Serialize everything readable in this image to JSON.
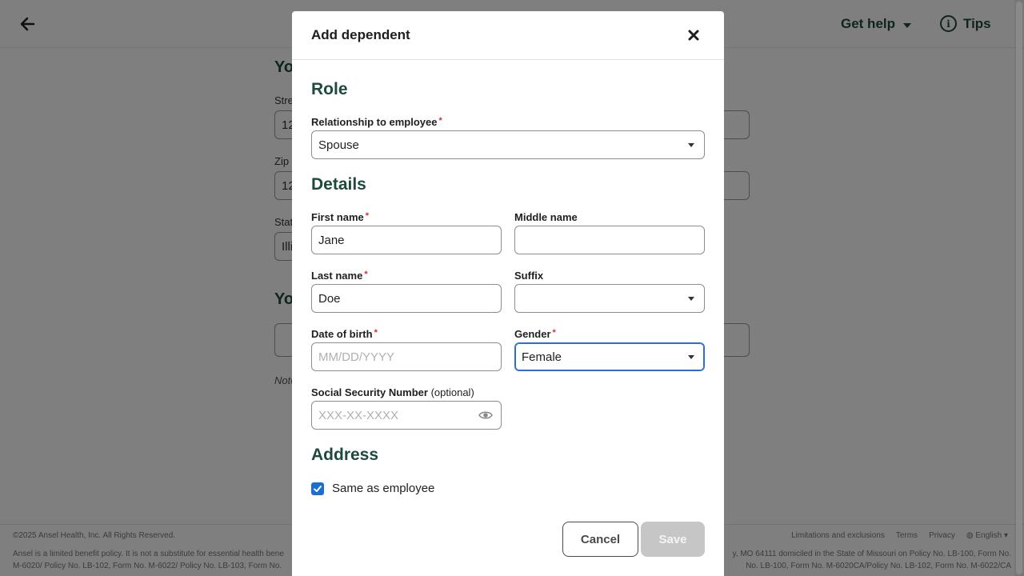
{
  "header": {
    "get_help_label": "Get help",
    "tips_label": "Tips",
    "tips_icon": "i"
  },
  "background": {
    "heading_1": "Yo",
    "street_label": "Stre",
    "street_value": "12",
    "zip_label": "Zip c",
    "zip_value": "12",
    "state_label": "Stat",
    "state_value": "Illi",
    "heading_2": "Yo",
    "note": "Note"
  },
  "footer": {
    "copyright": "©2025 Ansel Health, Inc. All Rights Reserved.",
    "links": [
      "Limitations and exclusions",
      "Terms",
      "Privacy",
      "English"
    ],
    "legal_left": "Ansel is a limited benefit policy. It is not a substitute for essential health bene",
    "legal_left_2": "M-6020/ Policy No. LB-102, Form No. M-6022/ Policy No. LB-103, Form No.",
    "legal_right": "y, MO 64111 domiciled in the State of Missouri on Policy No. LB-100, Form No.",
    "legal_right_2": "No. LB-100, Form No. M-6020CA/Policy No. LB-102, Form No. M-6022/CA"
  },
  "modal": {
    "title": "Add dependent",
    "role_heading": "Role",
    "relationship_label": "Relationship to employee",
    "relationship_value": "Spouse",
    "details_heading": "Details",
    "first_name_label": "First name",
    "first_name_value": "Jane",
    "middle_name_label": "Middle name",
    "middle_name_value": "",
    "last_name_label": "Last name",
    "last_name_value": "Doe",
    "suffix_label": "Suffix",
    "suffix_value": "",
    "dob_label": "Date of birth",
    "dob_placeholder": "MM/DD/YYYY",
    "gender_label": "Gender",
    "gender_value": "Female",
    "ssn_label": "Social Security Number",
    "ssn_optional": "(optional)",
    "ssn_placeholder": "XXX-XX-XXXX",
    "address_heading": "Address",
    "same_as_employee_label": "Same as employee",
    "same_as_employee_checked": true,
    "cancel_label": "Cancel",
    "save_label": "Save",
    "required_mark": "*"
  },
  "colors": {
    "brand_green": "#1d4a3b",
    "focus_blue": "#2d6cd8",
    "checkbox_blue": "#1a6fd6",
    "required_red": "#d93025",
    "disabled_gray": "#c6c6c6"
  }
}
